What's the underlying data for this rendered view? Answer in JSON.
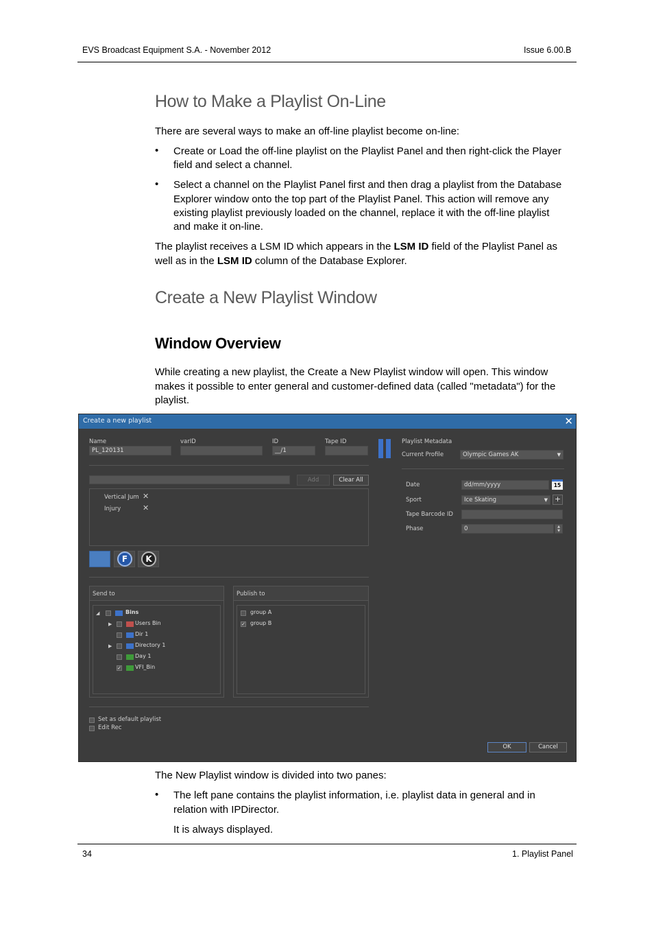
{
  "header": {
    "left": "EVS Broadcast Equipment S.A.  - November 2012",
    "right": "Issue 6.00.B"
  },
  "section1": {
    "title": "How to Make a Playlist On-Line",
    "intro": "There are several ways to make an off-line playlist become on-line:",
    "bullets": [
      {
        "line1": "Create or Load the off-line playlist on the Playlist Panel and then right-click the Player",
        "line2": "field and select a channel."
      },
      {
        "line1": "Select a channel on the Playlist Panel first and then drag a playlist from the Database",
        "line2": "Explorer window onto the top part of the Playlist Panel. This action will remove any",
        "line3": "existing playlist previously loaded on the channel, replace it with the off-line playlist",
        "line4": "and make it on-line."
      }
    ],
    "closing_a": "The playlist receives a LSM ID which appears in the ",
    "closing_b1": "LSM ID",
    "closing_c": " field of the Playlist Panel as",
    "closing_d": "well as in the ",
    "closing_b2": "LSM ID",
    "closing_e": " column of the Database Explorer."
  },
  "section2": {
    "title": "Create a New Playlist Window"
  },
  "section3": {
    "title": "Window Overview",
    "p1": "While creating a new playlist, the Create a New Playlist window will open. This window",
    "p2": "makes it possible to enter general and customer-defined data (called \"metadata\") for the",
    "p3": "playlist."
  },
  "dialog": {
    "title": "Create a new playlist",
    "close": "✕",
    "labels": {
      "name": "Name",
      "varid": "varID",
      "id": "ID",
      "tapeid": "Tape ID"
    },
    "values": {
      "name": "PL_120131",
      "id": "__/1"
    },
    "add": "Add",
    "clear_all": "Clear All",
    "keywords": [
      "Vertical Jum",
      "Injury"
    ],
    "remove_icon": "✕",
    "f_label": "F",
    "k_label": "K",
    "send_to": "Send to",
    "publish_to": "Publish to",
    "tree": [
      "Bins",
      "Users Bin",
      "Dir 1",
      "Directory 1",
      "Day 1",
      "VFI_Bin"
    ],
    "groups": [
      "group A",
      "group B"
    ],
    "default_playlist": "Set as default playlist",
    "edit_rec": "Edit Rec",
    "ok": "OK",
    "cancel": "Cancel",
    "metadata": {
      "title": "Playlist Metadata",
      "current_profile_label": "Current Profile",
      "current_profile": "Olympic Games AK",
      "date_label": "Date",
      "date_placeholder": "dd/mm/yyyy",
      "calendar_day": "15",
      "sport_label": "Sport",
      "sport": "Ice Skating",
      "plus": "+",
      "tape_barcode_label": "Tape Barcode ID",
      "phase_label": "Phase",
      "phase": "0"
    }
  },
  "section4": {
    "p1": "The New Playlist window is divided into two panes:",
    "b1_line1": "The left pane contains the playlist information, i.e. playlist data in general and in",
    "b1_line2": "relation with IPDirector.",
    "b1_line3": "It is always displayed."
  },
  "footer": {
    "left": "34",
    "right": "1. Playlist Panel"
  }
}
